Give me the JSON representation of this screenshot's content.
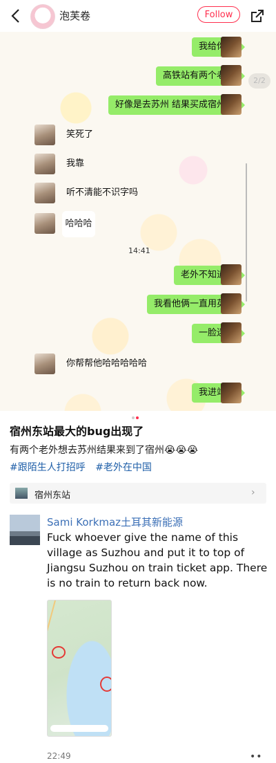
{
  "header": {
    "nickname": "泡芙卷",
    "follow_label": "Follow",
    "back_icon": "chevron-left-icon",
    "share_icon": "share-icon"
  },
  "image": {
    "page_indicator": "2/2",
    "chat_time": "14:41",
    "messages": [
      {
        "side": "right",
        "text": "我给你讲"
      },
      {
        "side": "right",
        "text": "高铁站有两个老外"
      },
      {
        "side": "right",
        "text": "好像是去苏州 结果买成宿州了"
      },
      {
        "side": "left",
        "text": "笑死了"
      },
      {
        "side": "left",
        "text": "我靠"
      },
      {
        "side": "left",
        "text": "听不清能不识字吗"
      },
      {
        "side": "left",
        "text": "哈哈哈"
      },
      {
        "side": "right",
        "text": "老外不知道啊"
      },
      {
        "side": "right",
        "text": "我看他俩一直用英语"
      },
      {
        "side": "right",
        "text": "一脸迷茫"
      },
      {
        "side": "left",
        "text": "你帮帮他哈哈哈哈哈"
      },
      {
        "side": "right",
        "text": "我进站了"
      }
    ]
  },
  "post": {
    "title": "宿州东站最大的bug出现了",
    "description": "有两个老外想去苏州结果来到了宿州😭😭😭",
    "tags": [
      "#跟陌生人打招呼",
      "#老外在中国"
    ],
    "location": "宿州东站"
  },
  "tweet": {
    "author": "Sami Korkmaz土耳其新能源",
    "text": "Fuck whoever give the name of this village as Suzhou and put it to top of Jiangsu Suzhou on train ticket app. There is no train to return back now.",
    "time": "22:49",
    "more": "••"
  },
  "colors": {
    "accent": "#ff2e4d",
    "bubble_green": "#95ec69",
    "tag_blue": "#1f5fa8",
    "tweet_name": "#3b6fb6"
  }
}
